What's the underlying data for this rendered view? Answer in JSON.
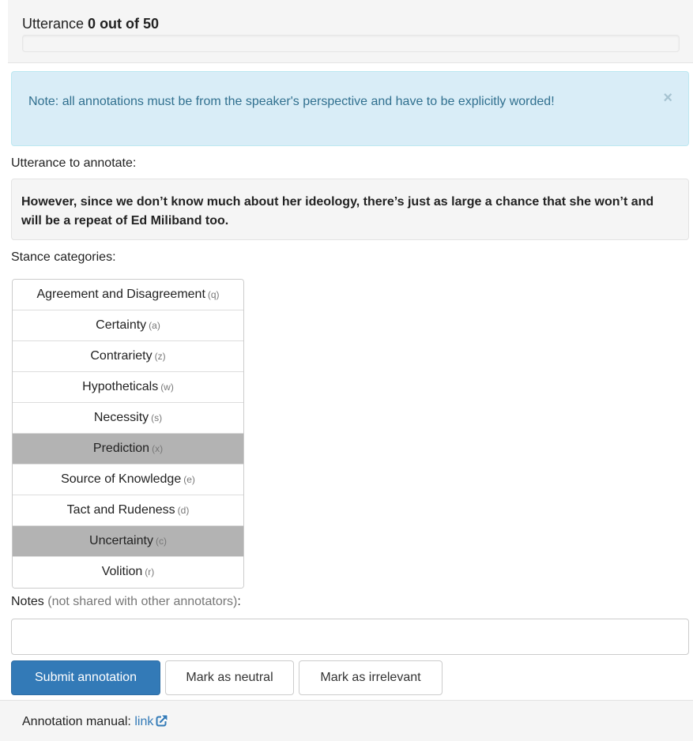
{
  "header": {
    "title_prefix": "Utterance ",
    "current": "0",
    "title_middle": " out of ",
    "total": "50",
    "progress_fraction": 0
  },
  "alert": {
    "text": "Note: all annotations must be from the speaker's perspective and have to be explicitly worded!",
    "close_label": "×"
  },
  "utterance": {
    "label": "Utterance to annotate:",
    "text": "However, since we don’t know much about her ideology, there’s just as large a chance that she won’t and will be a repeat of Ed Miliband too."
  },
  "stance": {
    "label": "Stance categories:",
    "items": [
      {
        "label": "Agreement and Disagreement",
        "key": "(q)",
        "selected": false
      },
      {
        "label": "Certainty",
        "key": "(a)",
        "selected": false
      },
      {
        "label": "Contrariety",
        "key": "(z)",
        "selected": false
      },
      {
        "label": "Hypotheticals",
        "key": "(w)",
        "selected": false
      },
      {
        "label": "Necessity",
        "key": "(s)",
        "selected": false
      },
      {
        "label": "Prediction",
        "key": "(x)",
        "selected": true
      },
      {
        "label": "Source of Knowledge",
        "key": "(e)",
        "selected": false
      },
      {
        "label": "Tact and Rudeness",
        "key": "(d)",
        "selected": false
      },
      {
        "label": "Uncertainty",
        "key": "(c)",
        "selected": true
      },
      {
        "label": "Volition",
        "key": "(r)",
        "selected": false
      }
    ]
  },
  "notes": {
    "label": "Notes",
    "muted": " (not shared with other annotators)",
    "colon": ":",
    "value": "",
    "placeholder": ""
  },
  "buttons": {
    "submit": "Submit annotation",
    "neutral": "Mark as neutral",
    "irrelevant": "Mark as irrelevant"
  },
  "footer": {
    "label": "Annotation manual: ",
    "link": "link",
    "icon": "external-link-icon"
  },
  "colors": {
    "primary": "#337ab7",
    "alert_bg": "#d9edf7",
    "alert_text": "#31708f",
    "selected_bg": "#b3b3b3"
  }
}
